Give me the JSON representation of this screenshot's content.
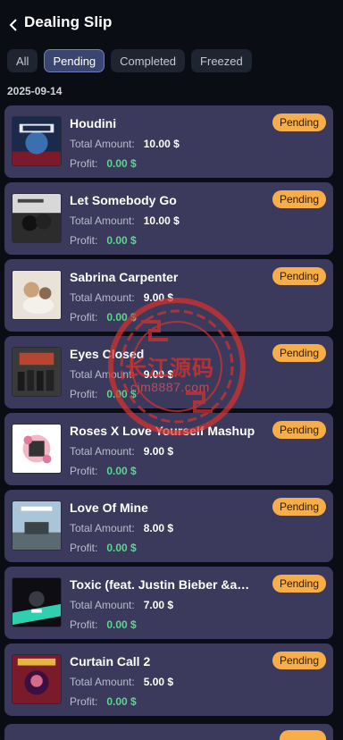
{
  "header": {
    "title": "Dealing Slip",
    "back_icon": "chevron-left-icon"
  },
  "tabs": [
    {
      "label": "All",
      "active": false
    },
    {
      "label": "Pending",
      "active": true
    },
    {
      "label": "Completed",
      "active": false
    },
    {
      "label": "Freezed",
      "active": false
    }
  ],
  "date": "2025-09-14",
  "labels": {
    "total_amount": "Total Amount:",
    "profit": "Profit:"
  },
  "items": [
    {
      "song": "Houdini",
      "amount": "10.00 $",
      "profit": "0.00 $",
      "status": "Pending"
    },
    {
      "song": "Let Somebody Go",
      "amount": "10.00 $",
      "profit": "0.00 $",
      "status": "Pending"
    },
    {
      "song": "Sabrina Carpenter",
      "amount": "9.00 $",
      "profit": "0.00 $",
      "status": "Pending"
    },
    {
      "song": "Eyes Closed",
      "amount": "9.00 $",
      "profit": "0.00 $",
      "status": "Pending"
    },
    {
      "song": "Roses X Love Yourself Mashup",
      "amount": "9.00 $",
      "profit": "0.00 $",
      "status": "Pending"
    },
    {
      "song": "Love Of Mine",
      "amount": "8.00 $",
      "profit": "0.00 $",
      "status": "Pending"
    },
    {
      "song": "Toxic (feat. Justin Bieber &a…",
      "amount": "7.00 $",
      "profit": "0.00 $",
      "status": "Pending"
    },
    {
      "song": "Curtain Call 2",
      "amount": "5.00 $",
      "profit": "0.00 $",
      "status": "Pending"
    }
  ],
  "watermark": {
    "text": "长江源码",
    "url": "cjm8887.com"
  },
  "colors": {
    "background": "#0b0d14",
    "card": "#3b3a5c",
    "badge": "#f7ad48",
    "profit": "#5bd68e",
    "active_tab": "#3b4670"
  }
}
